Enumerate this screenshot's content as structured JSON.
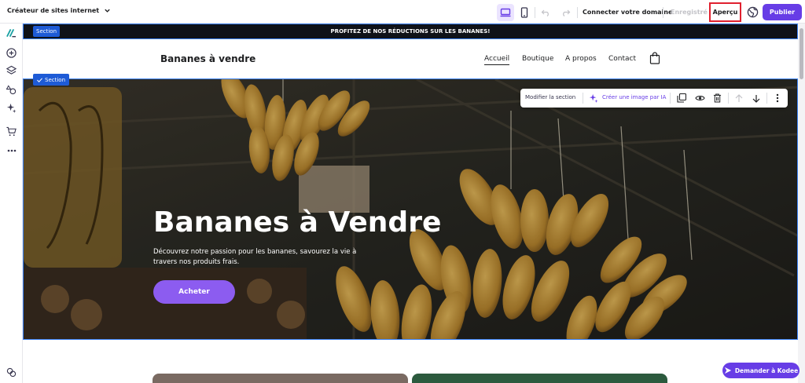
{
  "topbar": {
    "app_title": "Créateur de sites internet",
    "connect_domain": "Connecter votre domaine",
    "saved_status": "Enregistré",
    "preview": "Aperçu",
    "publish": "Publier"
  },
  "canvas": {
    "section_badge": "Section",
    "promo_text": "PROFITEZ DE NOS RÉDUCTIONS SUR LES BANANES!",
    "brand": "Bananes à vendre",
    "nav": [
      "Accueil",
      "Boutique",
      "A propos",
      "Contact"
    ],
    "hero_section_badge": "Section",
    "toolbar": {
      "edit_section": "Modifier la section",
      "ai_image": "Créer une image par IA"
    },
    "hero": {
      "title": "Bananes à Vendre",
      "description": "Découvrez notre passion pour les bananes, savourez la vie à travers nos produits frais.",
      "cta": "Acheter"
    }
  },
  "assistant": {
    "label": "Demander à Kodee"
  },
  "colors": {
    "accent": "#673de6",
    "selection": "#3b82f6",
    "preview_highlight": "#e0202f"
  }
}
